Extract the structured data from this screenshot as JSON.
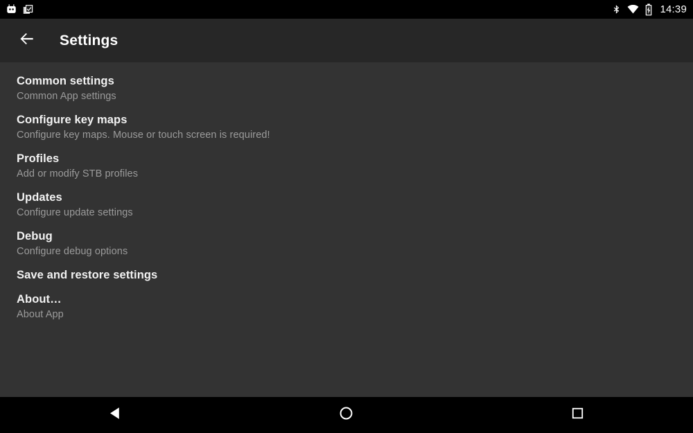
{
  "status_bar": {
    "notification_icons": [
      "app-robot-icon",
      "clipboard-check-icon"
    ],
    "system_icons": [
      "bluetooth-icon",
      "wifi-icon",
      "battery-charging-icon"
    ],
    "time": "14:39",
    "background_color": "#000000"
  },
  "toolbar": {
    "back_icon": "arrow-back-icon",
    "title": "Settings",
    "background_color": "#272727"
  },
  "content": {
    "background_color": "#333333",
    "preferences": [
      {
        "title": "Common settings",
        "summary": "Common App settings"
      },
      {
        "title": "Configure key maps",
        "summary": "Configure key maps. Mouse or touch screen is required!"
      },
      {
        "title": "Profiles",
        "summary": "Add or modify STB profiles"
      },
      {
        "title": "Updates",
        "summary": "Configure update settings"
      },
      {
        "title": "Debug",
        "summary": "Configure debug options"
      },
      {
        "title": "Save and restore settings",
        "summary": ""
      },
      {
        "title": "About…",
        "summary": "About App"
      }
    ]
  },
  "nav_bar": {
    "background_color": "#000000",
    "buttons": [
      {
        "name": "back-nav-icon"
      },
      {
        "name": "home-nav-icon"
      },
      {
        "name": "recents-nav-icon"
      }
    ]
  }
}
